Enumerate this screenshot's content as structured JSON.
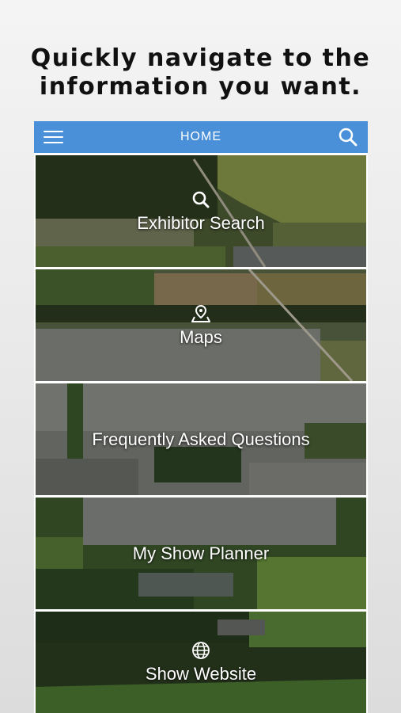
{
  "headline": {
    "line1": "Quickly navigate to the",
    "line2": "information you want."
  },
  "navbar": {
    "title": "HOME",
    "color": "#4a90d9",
    "left_icon": "menu-icon",
    "right_icon": "search-icon"
  },
  "tiles": [
    {
      "label": "Exhibitor Search",
      "icon": "search-icon"
    },
    {
      "label": "Maps",
      "icon": "map-pin-icon"
    },
    {
      "label": "Frequently Asked Questions",
      "icon": ""
    },
    {
      "label": "My Show Planner",
      "icon": ""
    },
    {
      "label": "Show Website",
      "icon": "globe-icon"
    }
  ]
}
